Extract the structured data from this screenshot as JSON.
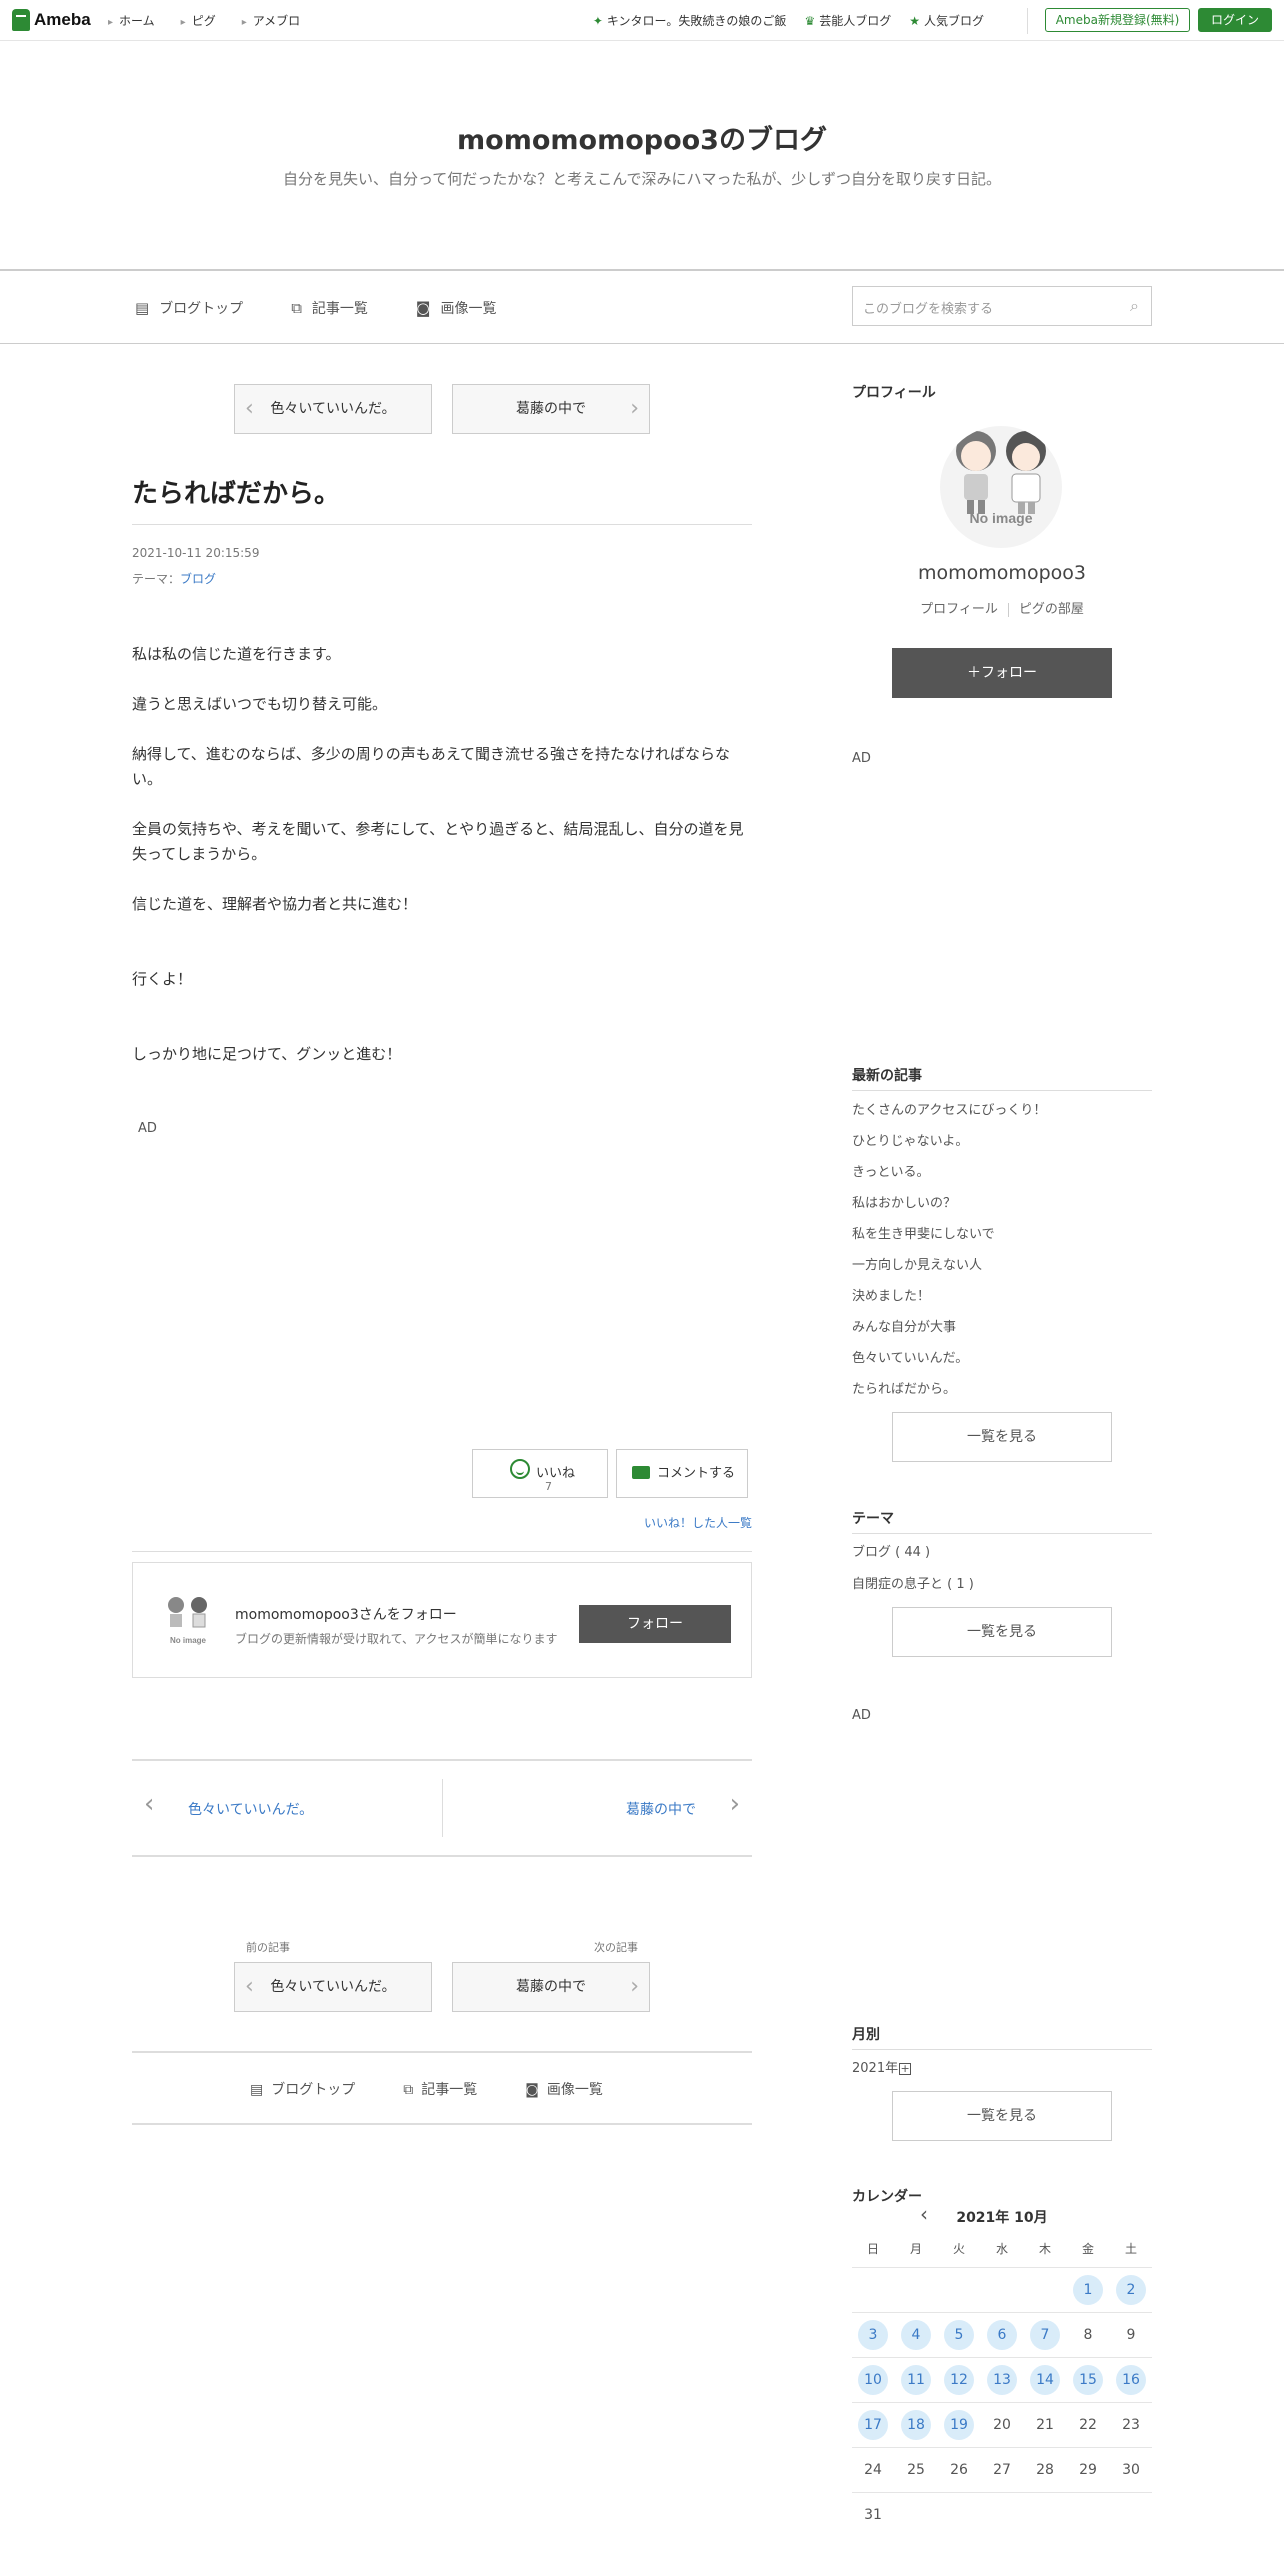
{
  "topbar": {
    "logo": "Ameba",
    "nav": [
      "ホーム",
      "ピグ",
      "アメブロ"
    ],
    "links": [
      "キンタロー。失敗続きの娘のご飯",
      "芸能人ブログ",
      "人気ブログ"
    ],
    "register": "Ameba新規登録(無料)",
    "login": "ログイン"
  },
  "header": {
    "title": "momomomopoo3のブログ",
    "description": "自分を見失い、自分って何だったかな？と考えこんで深みにハマった私が、少しずつ自分を取り戻す日記。"
  },
  "blognav": {
    "top": "ブログトップ",
    "list": "記事一覧",
    "images": "画像一覧",
    "search_placeholder": "このブログを検索する"
  },
  "article": {
    "prev_title": "色々いていいんだ。",
    "next_title": "葛藤の中で",
    "title": "たらればだから。",
    "date": "2021-10-11 20:15:59",
    "theme_label": "テーマ：",
    "theme": "ブログ",
    "paragraphs": [
      "私は私の信じた道を行きます。",
      "違うと思えばいつでも切り替え可能。",
      "納得して、進むのならば、多少の周りの声もあえて聞き流せる強さを持たなければならない。",
      "全員の気持ちや、考えを聞いて、参考にして、とやり過ぎると、結局混乱し、自分の道を見失ってしまうから。",
      "信じた道を、理解者や協力者と共に進む！",
      "行くよ！",
      "しっかり地に足つけて、グンッと進む！"
    ],
    "ad": "AD",
    "like_label": "いいね",
    "like_count": "7",
    "comment_label": "コメントする",
    "like_list": "いいね！した人一覧",
    "follow_name": "momomomopoo3さんをフォロー",
    "follow_sub": "ブログの更新情報が受け取れて、アクセスが簡単になります",
    "follow_button": "フォロー",
    "prev_label": "前の記事",
    "next_label": "次の記事"
  },
  "sidebar": {
    "profile_heading": "プロフィール",
    "no_image": "No image",
    "name": "momomomopoo3",
    "profile_link": "プロフィール",
    "pig_link": "ピグの部屋",
    "follow": "フォロー",
    "ad": "AD",
    "latest_heading": "最新の記事",
    "latest": [
      "たくさんのアクセスにびっくり！",
      "ひとりじゃないよ。",
      "きっといる。",
      "私はおかしいの？",
      "私を生き甲斐にしないで",
      "一方向しか見えない人",
      "決めました！",
      "みんな自分が大事",
      "色々いていいんだ。",
      "たらればだから。"
    ],
    "see_all": "一覧を見る",
    "theme_heading": "テーマ",
    "themes": [
      "ブログ ( 44 )",
      "自閉症の息子と ( 1 )"
    ],
    "monthly_heading": "月別",
    "year": "2021年",
    "calendar_heading": "カレンダー",
    "calendar_month": "2021年 10月",
    "dow": [
      "日",
      "月",
      "火",
      "水",
      "木",
      "金",
      "土"
    ],
    "days_with_posts": [
      1,
      2,
      3,
      4,
      5,
      6,
      7,
      10,
      11,
      12,
      13,
      14,
      15,
      16,
      17,
      18,
      19
    ]
  },
  "colors": {
    "brand": "#2d8a34",
    "link": "#3b7ac6",
    "dark_button": "#555555"
  }
}
